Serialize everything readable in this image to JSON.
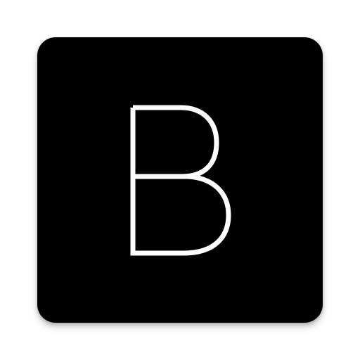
{
  "app_icon": {
    "letter": "B",
    "background_color": "#000000",
    "glyph_color": "#ffffff",
    "page_background": "#ffffff"
  }
}
